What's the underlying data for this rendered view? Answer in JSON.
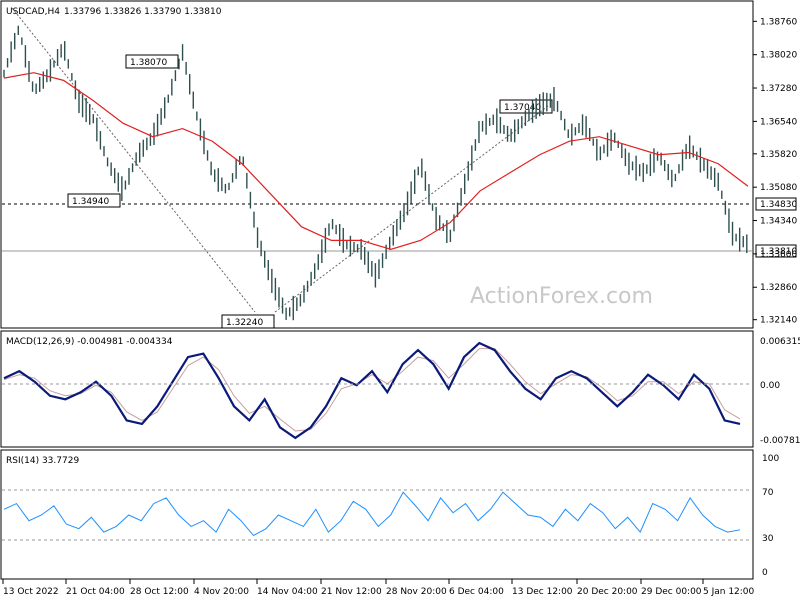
{
  "header": {
    "symbol": "USDCAD,H4",
    "ohlc": "1.33796 1.33826 1.33790 1.33810"
  },
  "watermark": "ActionForex.com",
  "colors": {
    "candle": "#2f4f4f",
    "ma": "#e02020",
    "macd": "#0a1a7a",
    "signal": "#c8a0a0",
    "rsi": "#1e90ff",
    "dashed_level": "#000000",
    "current_level": "#9a9a9a"
  },
  "chart_data": [
    {
      "type": "line",
      "panel": "price",
      "title": "USDCAD,H4",
      "x_ticks": [
        "13 Oct 2022",
        "21 Oct 04:00",
        "28 Oct 12:00",
        "4 Nov 20:00",
        "14 Nov 04:00",
        "21 Nov 12:00",
        "28 Nov 20:00",
        "6 Dec 04:00",
        "13 Dec 12:00",
        "20 Dec 20:00",
        "29 Dec 00:00",
        "5 Jan 12:00"
      ],
      "y_ticks": [
        "1.38760",
        "1.38020",
        "1.37280",
        "1.36540",
        "1.35820",
        "1.35080",
        "1.34340",
        "1.33600",
        "1.32860",
        "1.32140"
      ],
      "ylim": [
        1.32,
        1.391
      ],
      "series": [
        {
          "role": "price",
          "x": [
            0,
            5,
            10,
            15,
            20,
            25,
            30,
            35,
            40,
            45,
            50,
            55,
            60,
            65,
            70,
            75,
            80,
            85,
            90,
            95,
            100,
            105,
            110,
            115,
            120,
            125,
            130,
            135,
            140,
            145,
            150,
            155,
            160,
            165,
            170,
            175,
            180,
            185,
            190
          ],
          "values": [
            1.376,
            1.386,
            1.372,
            1.376,
            1.382,
            1.37,
            1.366,
            1.356,
            1.35,
            1.358,
            1.362,
            1.37,
            1.3807,
            1.366,
            1.354,
            1.35,
            1.358,
            1.34,
            1.33,
            1.3224,
            1.326,
            1.333,
            1.343,
            1.338,
            1.337,
            1.331,
            1.339,
            1.346,
            1.356,
            1.344,
            1.34,
            1.352,
            1.364,
            1.366,
            1.362,
            1.366,
            1.369,
            1.3704,
            1.362
          ]
        },
        {
          "role": "moving-average",
          "x": [
            0,
            10,
            20,
            30,
            40,
            50,
            60,
            70,
            80,
            90,
            100,
            110,
            120,
            130,
            140,
            150,
            160,
            170,
            180,
            190,
            200,
            210,
            220,
            230,
            240,
            250
          ],
          "values": [
            1.375,
            1.3762,
            1.3745,
            1.37,
            1.365,
            1.362,
            1.3638,
            1.361,
            1.356,
            1.349,
            1.342,
            1.339,
            1.339,
            1.337,
            1.339,
            1.343,
            1.35,
            1.354,
            1.358,
            1.361,
            1.362,
            1.36,
            1.358,
            1.3585,
            1.356,
            1.351
          ]
        }
      ],
      "annotations": [
        {
          "text": "1.38070",
          "value": 1.3807
        },
        {
          "text": "1.34940",
          "value": 1.3494
        },
        {
          "text": "1.32240",
          "value": 1.3224
        },
        {
          "text": "1.37040",
          "value": 1.3704
        }
      ],
      "levels": [
        {
          "text": "1.34830",
          "value": 1.3483,
          "style": "dashed"
        },
        {
          "text": "1.33810",
          "value": 1.3381,
          "style": "solid"
        }
      ]
    },
    {
      "type": "line",
      "panel": "macd",
      "title": "MACD(12,26,9) -0.004981 -0.004334",
      "y_ticks": [
        "0.006315",
        "0.00",
        "-0.007818"
      ],
      "ylim": [
        -0.0085,
        0.007
      ],
      "series": [
        {
          "role": "macd",
          "values": [
            0.001,
            0.002,
            0.0005,
            -0.0015,
            -0.002,
            -0.001,
            0.0005,
            -0.0015,
            -0.005,
            -0.0055,
            -0.003,
            0.0005,
            0.004,
            0.0045,
            0.001,
            -0.003,
            -0.005,
            -0.002,
            -0.006,
            -0.0075,
            -0.006,
            -0.003,
            0.001,
            0.0,
            0.002,
            -0.001,
            0.003,
            0.005,
            0.003,
            -0.0005,
            0.004,
            0.006,
            0.005,
            0.002,
            -0.0005,
            -0.002,
            0.001,
            0.002,
            0.001,
            -0.001,
            -0.003,
            -0.001,
            0.0015,
            0.0,
            -0.002,
            0.0015,
            -0.0005,
            -0.005,
            -0.0055
          ]
        },
        {
          "role": "signal",
          "values": [
            0.0008,
            0.0015,
            0.001,
            -0.0008,
            -0.0015,
            -0.0012,
            0.0,
            -0.001,
            -0.0038,
            -0.005,
            -0.0038,
            -0.0005,
            0.0028,
            0.004,
            0.0022,
            -0.0015,
            -0.004,
            -0.003,
            -0.0048,
            -0.0065,
            -0.0063,
            -0.004,
            -0.0005,
            0.0002,
            0.0015,
            0.0002,
            0.002,
            0.004,
            0.0035,
            0.001,
            0.003,
            0.0052,
            0.0052,
            0.003,
            0.0005,
            -0.0012,
            0.0002,
            0.0015,
            0.0012,
            -0.0003,
            -0.0022,
            -0.0015,
            0.0005,
            0.0005,
            -0.0012,
            0.0005,
            0.0002,
            -0.0035,
            -0.0048
          ]
        }
      ],
      "levels": [
        {
          "text": "0.00",
          "value": 0
        }
      ]
    },
    {
      "type": "line",
      "panel": "rsi",
      "title": "RSI(14) 33.7729",
      "y_ticks": [
        "100",
        "70",
        "30",
        "0"
      ],
      "ylim": [
        0,
        100
      ],
      "series": [
        {
          "role": "rsi",
          "values": [
            55,
            60,
            45,
            50,
            58,
            42,
            38,
            48,
            35,
            40,
            50,
            45,
            60,
            65,
            50,
            40,
            45,
            35,
            55,
            45,
            32,
            38,
            50,
            45,
            40,
            55,
            35,
            45,
            62,
            55,
            40,
            50,
            70,
            58,
            45,
            65,
            52,
            60,
            45,
            55,
            70,
            60,
            50,
            48,
            40,
            55,
            45,
            60,
            52,
            38,
            48,
            35,
            60,
            55,
            45,
            65,
            50,
            40,
            35,
            37
          ]
        }
      ],
      "levels": [
        {
          "value": 70
        },
        {
          "value": 30
        }
      ]
    }
  ]
}
